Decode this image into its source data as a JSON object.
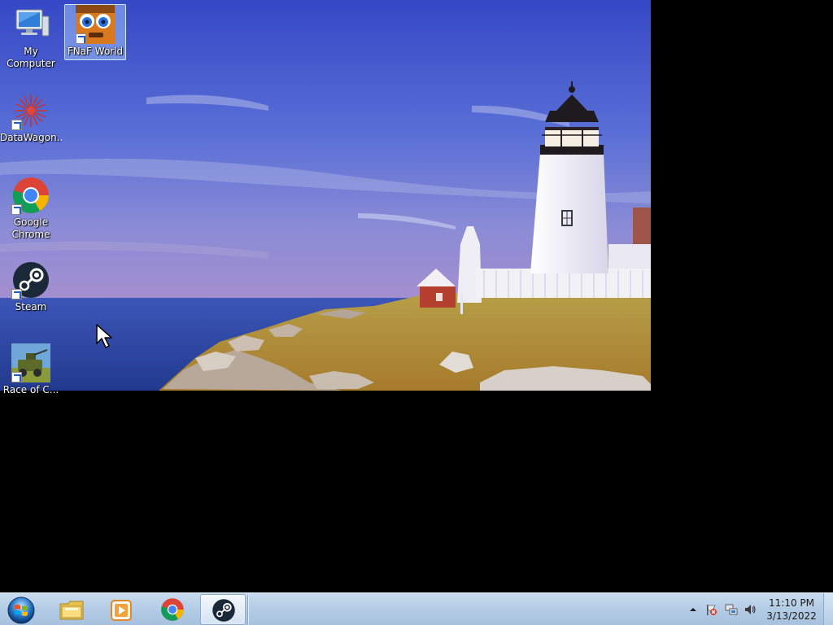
{
  "desktop": {
    "icons": [
      {
        "label": "My Computer",
        "icon": "computer-icon"
      },
      {
        "label": "FNaF World",
        "icon": "fnaf-world-icon"
      },
      {
        "label": "DataWagon...",
        "icon": "datawagon-icon"
      },
      {
        "label": "Google Chrome",
        "icon": "chrome-icon"
      },
      {
        "label": "Steam",
        "icon": "steam-icon"
      },
      {
        "label": "Race of C...",
        "icon": "game-jeep-icon"
      }
    ]
  },
  "taskbar": {
    "start": {
      "icon": "windows-start-icon"
    },
    "pinned": [
      {
        "name": "Windows Explorer",
        "icon": "folder-icon"
      },
      {
        "name": "Windows Media Player",
        "icon": "media-player-icon"
      },
      {
        "name": "Google Chrome",
        "icon": "chrome-icon"
      },
      {
        "name": "Steam",
        "icon": "steam-icon",
        "active": true
      }
    ],
    "tray": {
      "icons": [
        "show-hidden-icons-arrow",
        "action-center-flag-icon",
        "network-icon",
        "volume-icon"
      ],
      "time": "11:10 PM",
      "date": "3/13/2022"
    }
  },
  "colors": {
    "taskbar": "#b5cde6",
    "selection": "#b4d7ff",
    "sky_top": "#3a4fc4",
    "sea": "#2d4aa8"
  }
}
